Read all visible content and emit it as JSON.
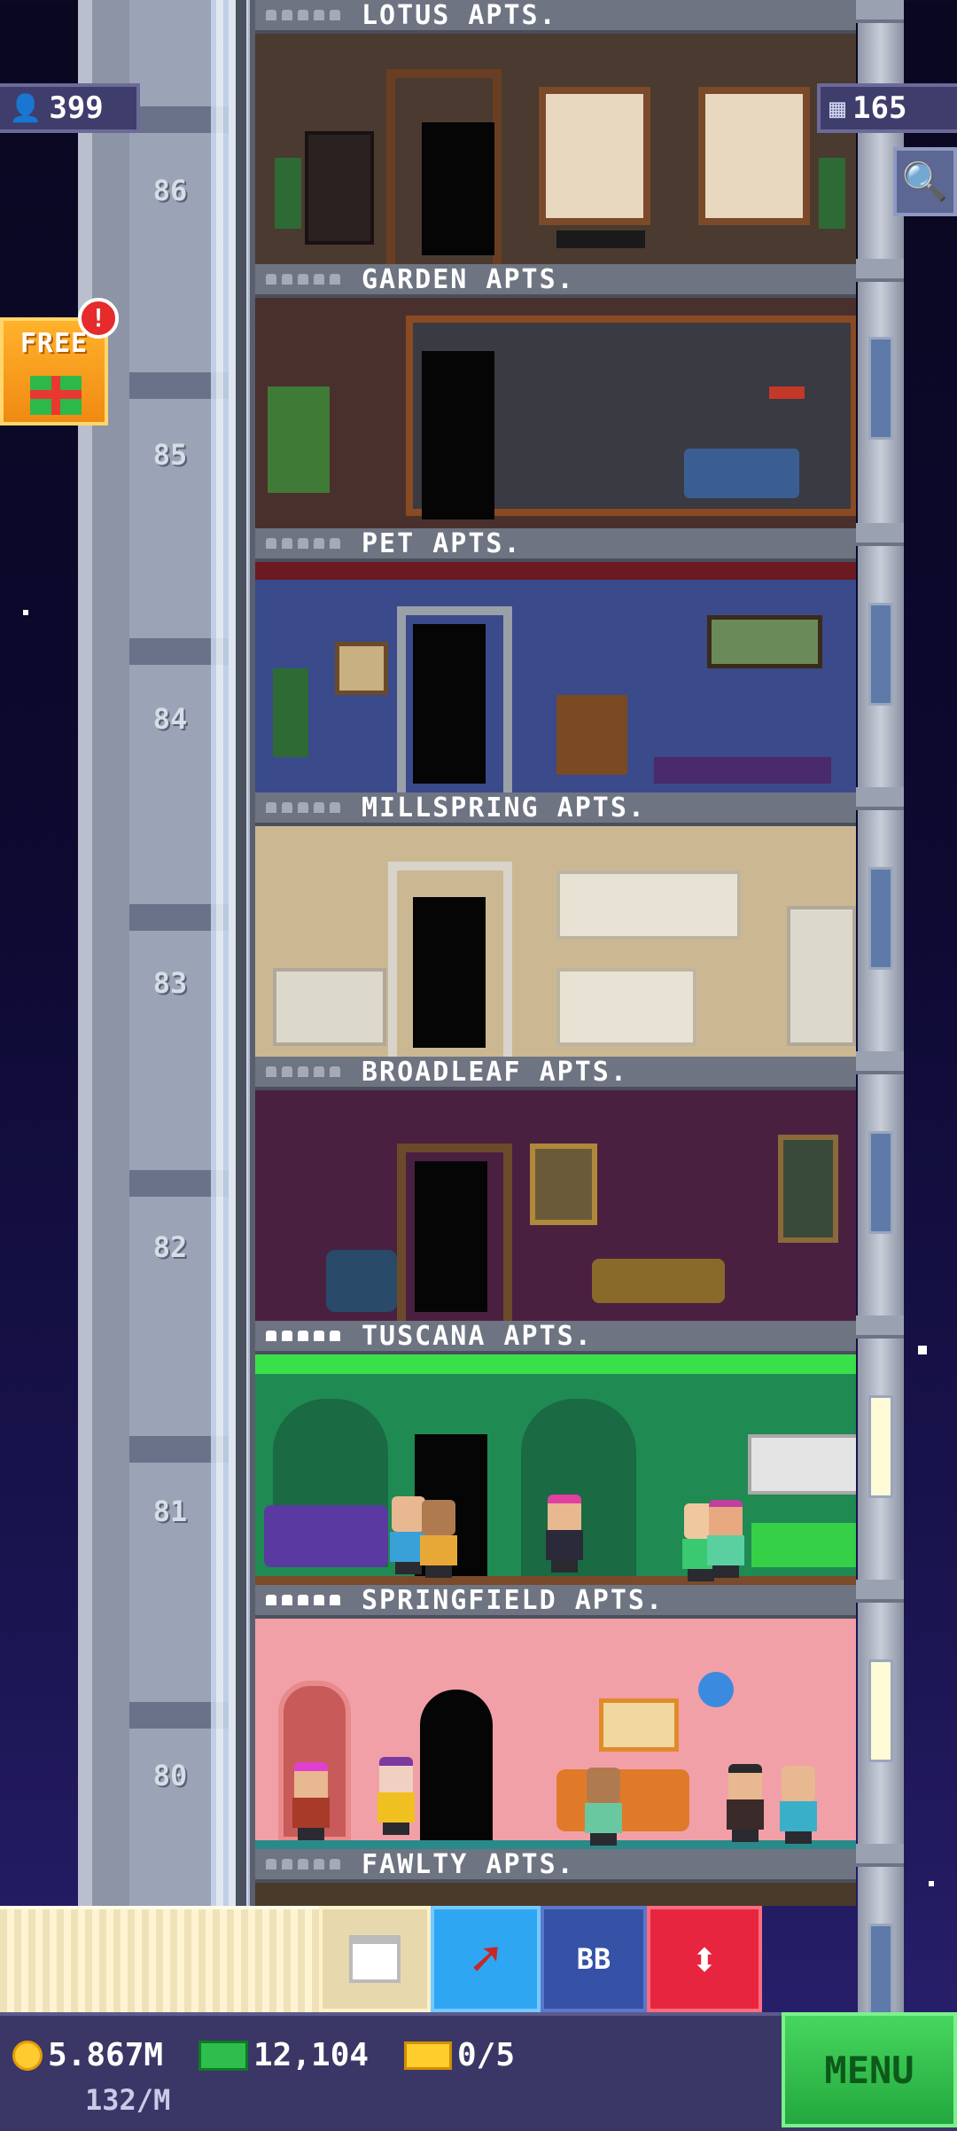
{
  "top_chips": {
    "population": "399",
    "floors": "165"
  },
  "free_gift": {
    "label": "FREE",
    "alert": "!"
  },
  "floors": [
    {
      "number": "86",
      "name": "LOTUS APTS.",
      "occupied": 0
    },
    {
      "number": "85",
      "name": "GARDEN APTS.",
      "occupied": 0
    },
    {
      "number": "84",
      "name": "PET APTS.",
      "occupied": 0
    },
    {
      "number": "83",
      "name": "MILLSPRING APTS.",
      "occupied": 0
    },
    {
      "number": "82",
      "name": "BROADLEAF APTS.",
      "occupied": 0
    },
    {
      "number": "81",
      "name": "TUSCANA APTS.",
      "occupied": 5
    },
    {
      "number": "80",
      "name": "SPRINGFIELD APTS.",
      "occupied": 5
    },
    {
      "number": "",
      "name": "FAWLTY APTS.",
      "occupied": 0
    }
  ],
  "toolbar": {
    "bb_label": "BB"
  },
  "bottom_bar": {
    "coins": "5.867M",
    "income": "132/M",
    "bux": "12,104",
    "tickets": "0/5",
    "menu_label": "MENU"
  },
  "colors": {
    "accent_green": "#2dbe4b",
    "coin_gold": "#ffcb2e",
    "alert_red": "#e52b2b"
  }
}
